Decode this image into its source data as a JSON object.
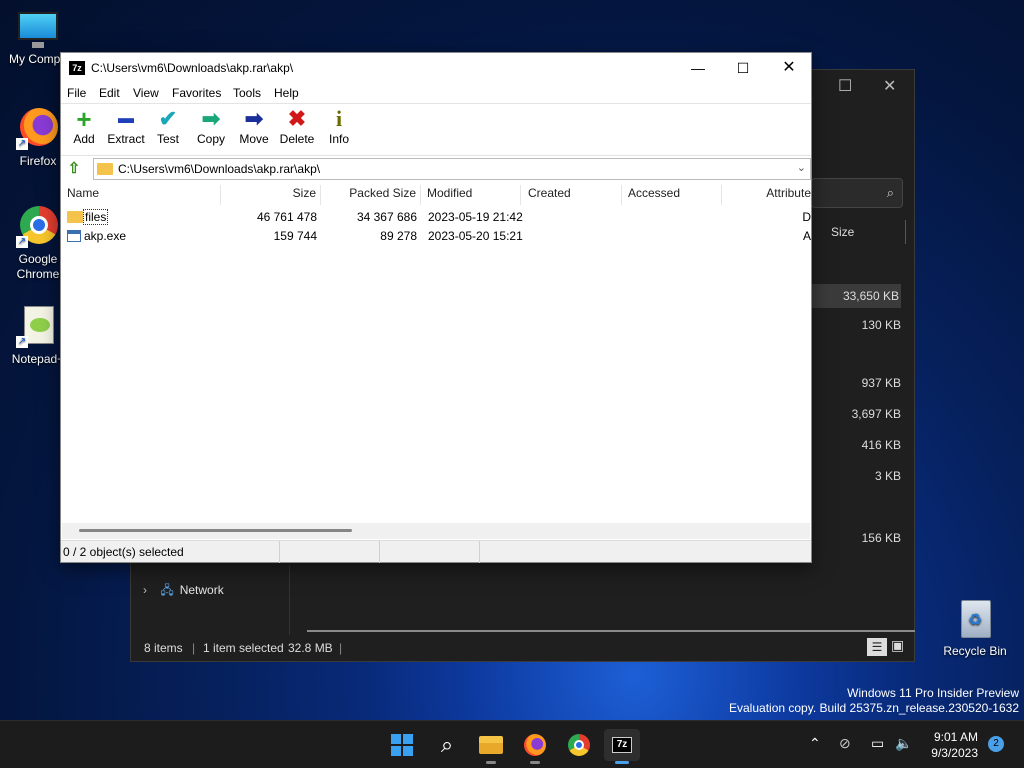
{
  "desktop": {
    "icons": [
      {
        "label": "My Compu",
        "icon": "monitor-icon"
      },
      {
        "label": "Firefox",
        "icon": "firefox-icon"
      },
      {
        "label": "Google Chrome",
        "icon": "chrome-icon"
      },
      {
        "label": "Notepad+",
        "icon": "notepad-plus-plus-icon"
      }
    ],
    "recycle_bin": {
      "label": "Recycle Bin",
      "icon": "recycle-bin-icon"
    },
    "watermark": {
      "line1": "Windows 11 Pro Insider Preview",
      "line2": "Evaluation copy. Build 25375.zn_release.230520-1632"
    }
  },
  "explorer": {
    "size_header": "Size",
    "sizes": [
      "33,650 KB",
      "130 KB",
      "937 KB",
      "3,697 KB",
      "416 KB",
      "3 KB",
      "156 KB"
    ],
    "nav_item": "Network",
    "status": {
      "items": "8 items",
      "selected": "1 item selected",
      "size": "32.8 MB"
    }
  },
  "sevenzip": {
    "app_icon_text": "7z",
    "title": "C:\\Users\\vm6\\Downloads\\akp.rar\\akp\\",
    "window_buttons": {
      "minimize": "—",
      "maximize": "☐",
      "close": "✕"
    },
    "menu": [
      "File",
      "Edit",
      "View",
      "Favorites",
      "Tools",
      "Help"
    ],
    "toolbar": [
      {
        "label": "Add",
        "glyph": "+",
        "color": "#2aa52a"
      },
      {
        "label": "Extract",
        "glyph": "▬",
        "color": "#1f3fb8"
      },
      {
        "label": "Test",
        "glyph": "✔",
        "color": "#1aa7b8"
      },
      {
        "label": "Copy",
        "glyph": "➡",
        "color": "#1aa77a"
      },
      {
        "label": "Move",
        "glyph": "➡",
        "color": "#1a2f9a"
      },
      {
        "label": "Delete",
        "glyph": "✖",
        "color": "#d01818"
      },
      {
        "label": "Info",
        "glyph": "i",
        "color": "#6a6a00"
      }
    ],
    "address": "C:\\Users\\vm6\\Downloads\\akp.rar\\akp\\",
    "columns": [
      "Name",
      "Size",
      "Packed Size",
      "Modified",
      "Created",
      "Accessed",
      "Attribute"
    ],
    "rows": [
      {
        "name": "files",
        "type": "folder",
        "size": "46 761 478",
        "packed": "34 367 686",
        "modified": "2023-05-19 21:42",
        "attr": "D"
      },
      {
        "name": "akp.exe",
        "type": "exe",
        "size": "159 744",
        "packed": "89 278",
        "modified": "2023-05-20 15:21",
        "attr": "A"
      }
    ],
    "status": "0 / 2 object(s) selected"
  },
  "taskbar": {
    "apps": [
      "start-icon",
      "search-icon",
      "file-explorer-icon",
      "firefox-icon",
      "chrome-icon",
      "7zip-icon"
    ],
    "clock": {
      "time": "9:01 AM",
      "date": "9/3/2023"
    },
    "notifications": "2"
  }
}
